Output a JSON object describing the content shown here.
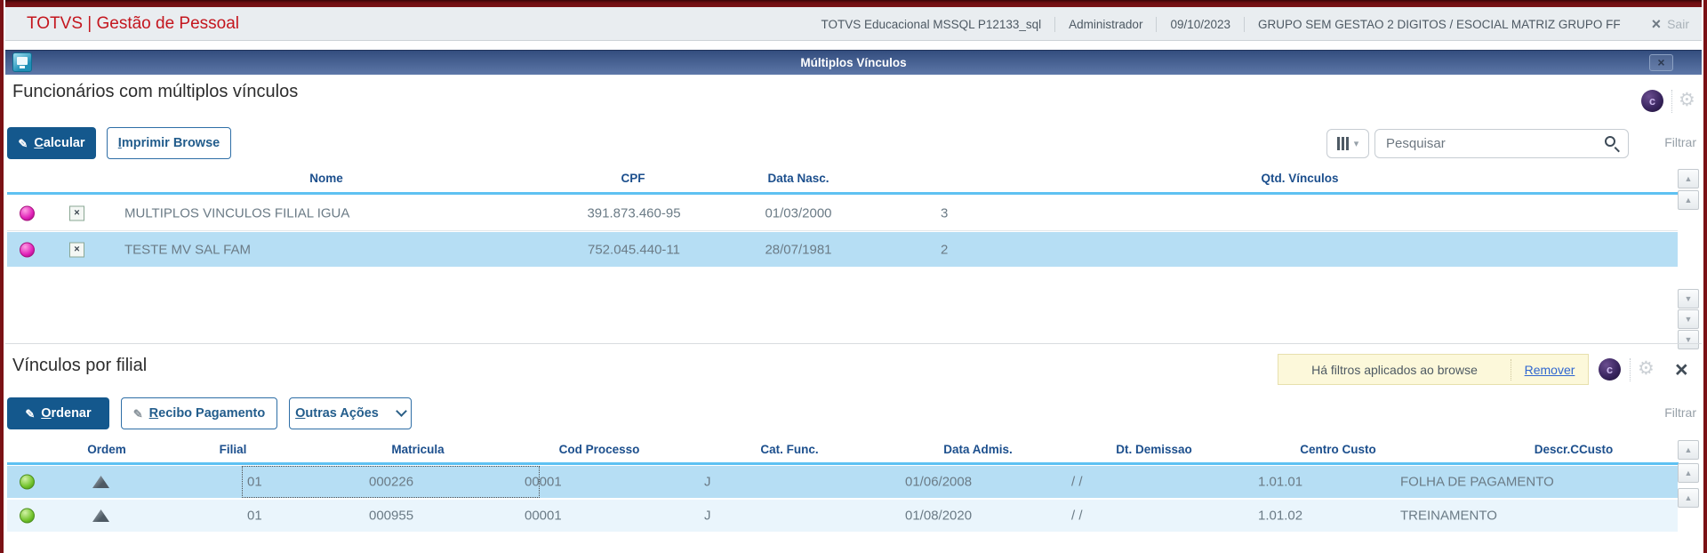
{
  "app": {
    "title": "TOTVS | Gestão de Pessoal",
    "environment": "TOTVS Educacional MSSQL P12133_sql",
    "user": "Administrador",
    "date": "09/10/2023",
    "group": "GRUPO SEM GESTAO 2 DIGITOS / ESOCIAL MATRIZ GRUPO FF",
    "logout_label": "Sair"
  },
  "window": {
    "title": "Múltiplos Vínculos"
  },
  "icons": {
    "close_glyph": "×",
    "sair_glyph": "×",
    "pencil_glyph": "✎",
    "gear_glyph": "⚙",
    "assistant_glyph": "c",
    "columns_dd_glyph": "▾",
    "up_glyph": "▲",
    "down_glyph": "▼",
    "excel_glyph": "×"
  },
  "section1": {
    "heading": "Funcionários com múltiplos vínculos",
    "buttons": {
      "calcular": {
        "key": "C",
        "rest": "alcular"
      },
      "imprimir": {
        "key": "I",
        "rest": "mprimir Browse"
      }
    },
    "search": {
      "placeholder": "Pesquisar"
    },
    "filter_label": "Filtrar",
    "table": {
      "columns": [
        "Nome",
        "CPF",
        "Data Nasc.",
        "Qtd. Vínculos"
      ],
      "rows": [
        {
          "nome": "MULTIPLOS VINCULOS FILIAL IGUA",
          "cpf": "391.873.460-95",
          "data_nasc": "01/03/2000",
          "qtd": "3"
        },
        {
          "nome": "TESTE MV SAL FAM",
          "cpf": "752.045.440-11",
          "data_nasc": "28/07/1981",
          "qtd": "2"
        }
      ]
    }
  },
  "section2": {
    "heading": "Vínculos por filial",
    "filter_notice": {
      "text": "Há filtros aplicados ao browse",
      "action": "Remover"
    },
    "buttons": {
      "ordenar": {
        "key": "O",
        "rest": "rdenar"
      },
      "recibo": {
        "key": "R",
        "rest": "ecibo Pagamento"
      },
      "outras": {
        "key": "O",
        "rest": "utras Ações"
      }
    },
    "filter_label": "Filtrar",
    "table": {
      "columns": [
        "Ordem",
        "Filial",
        "Matricula",
        "Cod Processo",
        "Cat. Func.",
        "Data Admis.",
        "Dt. Demissao",
        "Centro Custo",
        "Descr.CCusto"
      ],
      "rows": [
        {
          "filial": "01",
          "matricula": "000226",
          "cod_processo": "00001",
          "cat_func": "J",
          "data_admis": "01/06/2008",
          "dt_demissao": "/ /",
          "centro_custo": "1.01.01",
          "descr_ccusto": "FOLHA DE PAGAMENTO"
        },
        {
          "filial": "01",
          "matricula": "000955",
          "cod_processo": "00001",
          "cat_func": "J",
          "data_admis": "01/08/2020",
          "dt_demissao": "/ /",
          "centro_custo": "1.01.02",
          "descr_ccusto": "TREINAMENTO"
        }
      ]
    }
  },
  "colors": {
    "accent_blue": "#14588d",
    "selected_row": "#b6def4",
    "alt_row": "#eaf5fc",
    "header_text": "#1c4f8d",
    "grid_underline": "#5ec1f2",
    "titlebar_blue": "#41598b",
    "chrome_red": "#7a1115",
    "notice_bg": "#fcf8da",
    "brand_red": "#c4161e"
  }
}
